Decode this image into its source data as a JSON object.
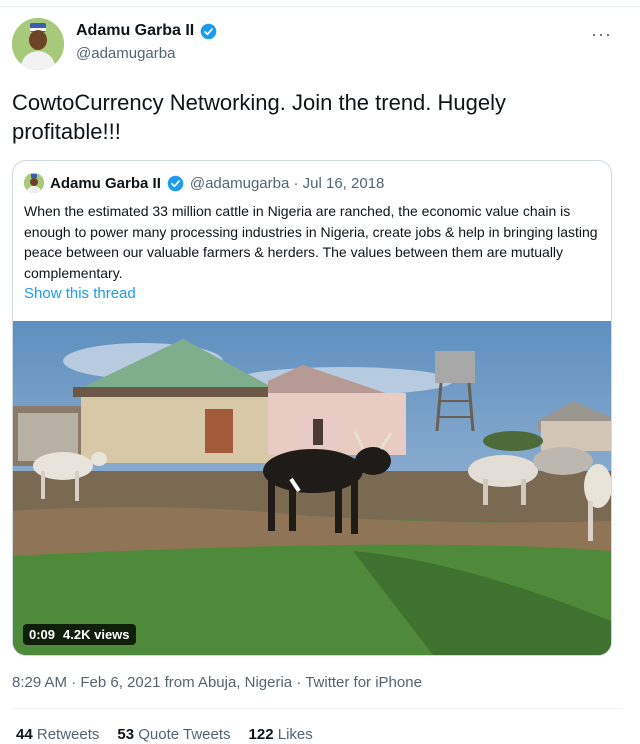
{
  "author": {
    "name": "Adamu Garba II",
    "handle": "@adamugarba"
  },
  "more_glyph": "···",
  "tweet": {
    "text": "CowtoCurrency Networking. Join the trend. Hugely profitable!!!"
  },
  "quoted": {
    "name": "Adamu Garba II",
    "meta": "@adamugarba · Jul 16, 2018",
    "text": "When the estimated 33 million cattle in Nigeria are ranched, the economic value chain is enough to power many processing industries in Nigeria, create jobs & help in bringing lasting peace between our valuable farmers & herders. The values between them are mutually complementary.",
    "show_thread": "Show this thread"
  },
  "video": {
    "duration": "0:09",
    "views": "4.2K views"
  },
  "timestamp": "8:29 AM · Feb 6, 2021 from Abuja, Nigeria · Twitter for iPhone",
  "stats": {
    "retweets_count": "44",
    "retweets_label": "Retweets",
    "quotes_count": "53",
    "quotes_label": "Quote Tweets",
    "likes_count": "122",
    "likes_label": "Likes"
  },
  "colors": {
    "link": "#1d9bf0",
    "verified": "#1d9bf0",
    "muted": "#536471"
  }
}
